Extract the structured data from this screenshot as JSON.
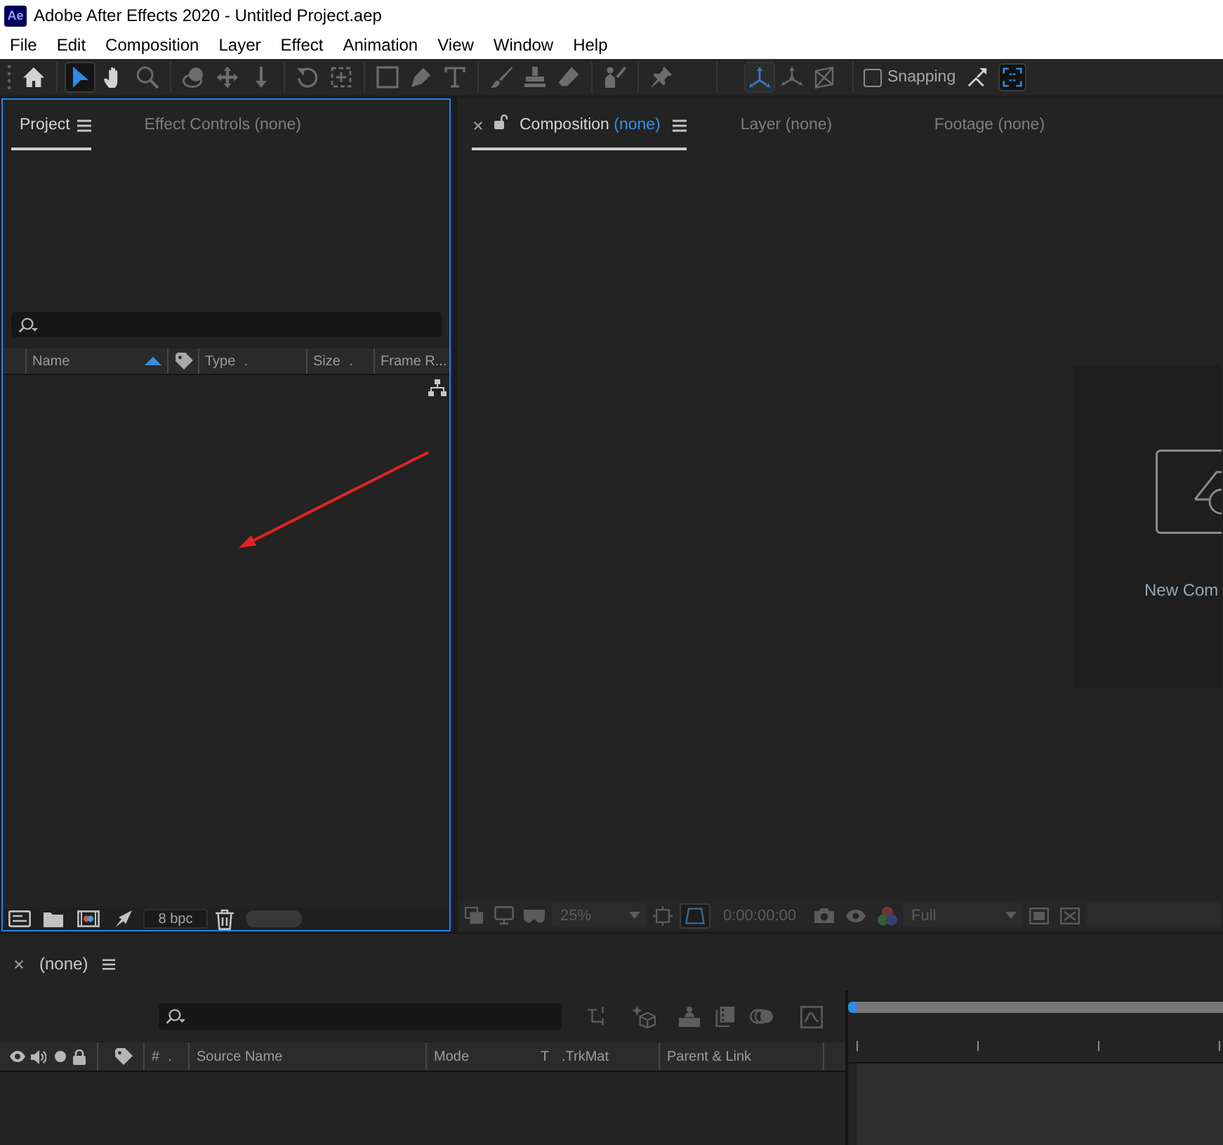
{
  "window": {
    "logo": "Ae",
    "title": "Adobe After Effects 2020 - Untitled Project.aep"
  },
  "menu": [
    "File",
    "Edit",
    "Composition",
    "Layer",
    "Effect",
    "Animation",
    "View",
    "Window",
    "Help"
  ],
  "toolbar": {
    "tool_groups": [
      [
        {
          "kind": "home",
          "selected": false,
          "disabled": false
        }
      ],
      [
        {
          "kind": "selection",
          "selected": true,
          "disabled": false
        },
        {
          "kind": "hand",
          "selected": false,
          "disabled": false
        },
        {
          "kind": "zoom",
          "selected": false,
          "disabled": true
        }
      ],
      [
        {
          "kind": "orbit",
          "selected": false,
          "disabled": true
        },
        {
          "kind": "pan",
          "selected": false,
          "disabled": true
        },
        {
          "kind": "dolly",
          "selected": false,
          "disabled": true
        }
      ],
      [
        {
          "kind": "rotate",
          "selected": false,
          "disabled": true
        },
        {
          "kind": "anchor",
          "selected": false,
          "disabled": true
        }
      ],
      [
        {
          "kind": "rectangle",
          "selected": false,
          "disabled": true
        },
        {
          "kind": "pen",
          "selected": false,
          "disabled": true
        },
        {
          "kind": "type",
          "selected": false,
          "disabled": true
        }
      ],
      [
        {
          "kind": "brush",
          "selected": false,
          "disabled": true
        },
        {
          "kind": "stamp",
          "selected": false,
          "disabled": true
        },
        {
          "kind": "eraser",
          "selected": false,
          "disabled": true
        }
      ],
      [
        {
          "kind": "roto",
          "selected": false,
          "disabled": true
        }
      ],
      [
        {
          "kind": "pin",
          "selected": false,
          "disabled": true
        }
      ]
    ],
    "axis_modes": [
      {
        "kind": "local",
        "selected": true
      },
      {
        "kind": "world",
        "selected": false
      },
      {
        "kind": "view",
        "selected": false
      }
    ],
    "snapping": {
      "label": "Snapping",
      "checked": false
    },
    "snap_options": [
      {
        "kind": "snap-edges",
        "selected": false
      },
      {
        "kind": "extents",
        "selected": true
      }
    ]
  },
  "project_panel": {
    "focused": true,
    "tabs": [
      {
        "label": "Project",
        "selected": true,
        "closable": false
      },
      {
        "label": "Effect Controls",
        "detail": "(none)",
        "selected": false,
        "closable": false
      }
    ],
    "columns": [
      {
        "kind": "text",
        "label": "Name",
        "sort_ascending": true
      },
      {
        "kind": "label"
      },
      {
        "kind": "text",
        "label": "Type",
        "mark": "."
      },
      {
        "kind": "text",
        "label": "Size",
        "mark": "."
      },
      {
        "kind": "text",
        "label": "Frame R..."
      }
    ],
    "bit_depth": "8 bpc",
    "annotations": [
      {
        "kind": "arrow"
      }
    ]
  },
  "composition_panel": {
    "focused": false,
    "locked": false,
    "tabs": [
      {
        "label": "Composition",
        "detail": "(none)",
        "selected": true,
        "closable": true
      },
      {
        "label": "Layer",
        "detail": "(none)",
        "selected": false,
        "closable": false
      },
      {
        "label": "Footage",
        "detail": "(none)",
        "selected": false,
        "closable": false
      }
    ],
    "new_composition": {
      "label": "New Com"
    },
    "viewer_bar": {
      "disabled": true,
      "zoom": "25%",
      "shape_toggle_on": true,
      "timecode": "0:00:00:00",
      "resolution": "Full"
    }
  },
  "timeline": {
    "tab": {
      "label": "(none)",
      "closable": true
    },
    "columns": [
      {
        "kind": "switches"
      },
      {
        "kind": "label"
      },
      {
        "kind": "text",
        "label": "#",
        "mark": "."
      },
      {
        "kind": "text",
        "label": "Source Name"
      },
      {
        "kind": "text",
        "label": "Mode"
      },
      {
        "kind": "text",
        "label": "T"
      },
      {
        "kind": "text",
        "label": ".TrkMat"
      },
      {
        "kind": "text",
        "label": "Parent & Link"
      }
    ]
  }
}
